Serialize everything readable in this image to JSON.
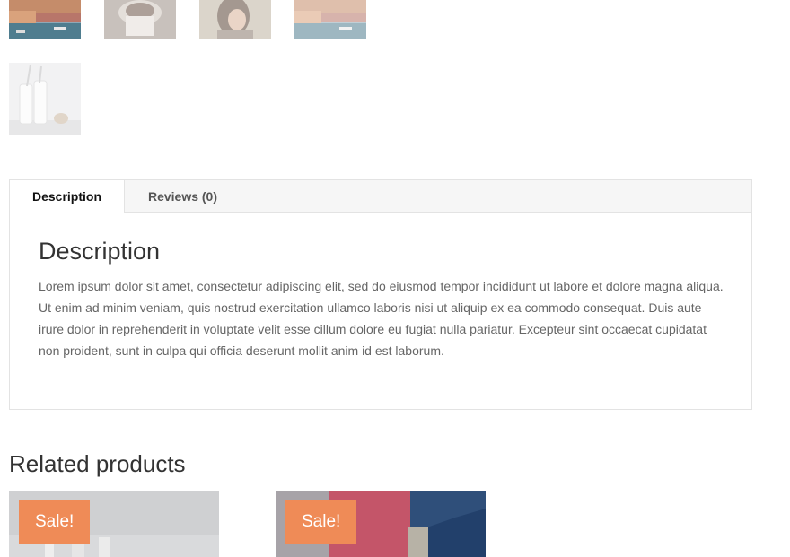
{
  "gallery": {
    "thumbnails": [
      {
        "name": "city-harbor",
        "dimmed": false
      },
      {
        "name": "coffee-cup",
        "dimmed": true
      },
      {
        "name": "woman-portrait",
        "dimmed": true
      },
      {
        "name": "city-harbor-2",
        "dimmed": true
      },
      {
        "name": "milk-bottles",
        "dimmed": true
      }
    ]
  },
  "tabs": {
    "description_label": "Description",
    "reviews_label": "Reviews (0)"
  },
  "description": {
    "heading": "Description",
    "body": "Lorem ipsum dolor sit amet, consectetur adipiscing elit, sed do eiusmod tempor incididunt ut labore et dolore magna aliqua. Ut enim ad minim veniam, quis nostrud exercitation ullamco laboris nisi ut aliquip ex ea commodo consequat. Duis aute irure dolor in reprehenderit in voluptate velit esse cillum dolore eu fugiat nulla pariatur. Excepteur sint occaecat cupidatat non proident, sunt in culpa qui officia deserunt mollit anim id est laborum."
  },
  "related": {
    "heading": "Related products",
    "products": [
      {
        "badge": "Sale!"
      },
      {
        "badge": "Sale!"
      }
    ]
  },
  "colors": {
    "sale_badge": "#ef8b57",
    "border": "#e3e3e3",
    "tab_bar": "#f6f6f6"
  }
}
